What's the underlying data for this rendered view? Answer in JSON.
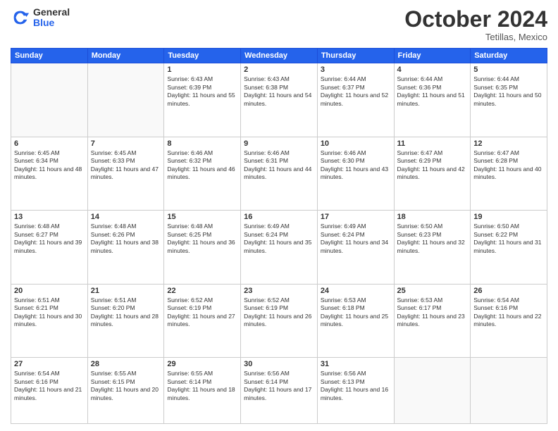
{
  "header": {
    "logo_general": "General",
    "logo_blue": "Blue",
    "month_year": "October 2024",
    "location": "Tetillas, Mexico"
  },
  "days_of_week": [
    "Sunday",
    "Monday",
    "Tuesday",
    "Wednesday",
    "Thursday",
    "Friday",
    "Saturday"
  ],
  "weeks": [
    [
      {
        "day": "",
        "sunrise": "",
        "sunset": "",
        "daylight": ""
      },
      {
        "day": "",
        "sunrise": "",
        "sunset": "",
        "daylight": ""
      },
      {
        "day": "1",
        "sunrise": "Sunrise: 6:43 AM",
        "sunset": "Sunset: 6:39 PM",
        "daylight": "Daylight: 11 hours and 55 minutes."
      },
      {
        "day": "2",
        "sunrise": "Sunrise: 6:43 AM",
        "sunset": "Sunset: 6:38 PM",
        "daylight": "Daylight: 11 hours and 54 minutes."
      },
      {
        "day": "3",
        "sunrise": "Sunrise: 6:44 AM",
        "sunset": "Sunset: 6:37 PM",
        "daylight": "Daylight: 11 hours and 52 minutes."
      },
      {
        "day": "4",
        "sunrise": "Sunrise: 6:44 AM",
        "sunset": "Sunset: 6:36 PM",
        "daylight": "Daylight: 11 hours and 51 minutes."
      },
      {
        "day": "5",
        "sunrise": "Sunrise: 6:44 AM",
        "sunset": "Sunset: 6:35 PM",
        "daylight": "Daylight: 11 hours and 50 minutes."
      }
    ],
    [
      {
        "day": "6",
        "sunrise": "Sunrise: 6:45 AM",
        "sunset": "Sunset: 6:34 PM",
        "daylight": "Daylight: 11 hours and 48 minutes."
      },
      {
        "day": "7",
        "sunrise": "Sunrise: 6:45 AM",
        "sunset": "Sunset: 6:33 PM",
        "daylight": "Daylight: 11 hours and 47 minutes."
      },
      {
        "day": "8",
        "sunrise": "Sunrise: 6:46 AM",
        "sunset": "Sunset: 6:32 PM",
        "daylight": "Daylight: 11 hours and 46 minutes."
      },
      {
        "day": "9",
        "sunrise": "Sunrise: 6:46 AM",
        "sunset": "Sunset: 6:31 PM",
        "daylight": "Daylight: 11 hours and 44 minutes."
      },
      {
        "day": "10",
        "sunrise": "Sunrise: 6:46 AM",
        "sunset": "Sunset: 6:30 PM",
        "daylight": "Daylight: 11 hours and 43 minutes."
      },
      {
        "day": "11",
        "sunrise": "Sunrise: 6:47 AM",
        "sunset": "Sunset: 6:29 PM",
        "daylight": "Daylight: 11 hours and 42 minutes."
      },
      {
        "day": "12",
        "sunrise": "Sunrise: 6:47 AM",
        "sunset": "Sunset: 6:28 PM",
        "daylight": "Daylight: 11 hours and 40 minutes."
      }
    ],
    [
      {
        "day": "13",
        "sunrise": "Sunrise: 6:48 AM",
        "sunset": "Sunset: 6:27 PM",
        "daylight": "Daylight: 11 hours and 39 minutes."
      },
      {
        "day": "14",
        "sunrise": "Sunrise: 6:48 AM",
        "sunset": "Sunset: 6:26 PM",
        "daylight": "Daylight: 11 hours and 38 minutes."
      },
      {
        "day": "15",
        "sunrise": "Sunrise: 6:48 AM",
        "sunset": "Sunset: 6:25 PM",
        "daylight": "Daylight: 11 hours and 36 minutes."
      },
      {
        "day": "16",
        "sunrise": "Sunrise: 6:49 AM",
        "sunset": "Sunset: 6:24 PM",
        "daylight": "Daylight: 11 hours and 35 minutes."
      },
      {
        "day": "17",
        "sunrise": "Sunrise: 6:49 AM",
        "sunset": "Sunset: 6:24 PM",
        "daylight": "Daylight: 11 hours and 34 minutes."
      },
      {
        "day": "18",
        "sunrise": "Sunrise: 6:50 AM",
        "sunset": "Sunset: 6:23 PM",
        "daylight": "Daylight: 11 hours and 32 minutes."
      },
      {
        "day": "19",
        "sunrise": "Sunrise: 6:50 AM",
        "sunset": "Sunset: 6:22 PM",
        "daylight": "Daylight: 11 hours and 31 minutes."
      }
    ],
    [
      {
        "day": "20",
        "sunrise": "Sunrise: 6:51 AM",
        "sunset": "Sunset: 6:21 PM",
        "daylight": "Daylight: 11 hours and 30 minutes."
      },
      {
        "day": "21",
        "sunrise": "Sunrise: 6:51 AM",
        "sunset": "Sunset: 6:20 PM",
        "daylight": "Daylight: 11 hours and 28 minutes."
      },
      {
        "day": "22",
        "sunrise": "Sunrise: 6:52 AM",
        "sunset": "Sunset: 6:19 PM",
        "daylight": "Daylight: 11 hours and 27 minutes."
      },
      {
        "day": "23",
        "sunrise": "Sunrise: 6:52 AM",
        "sunset": "Sunset: 6:19 PM",
        "daylight": "Daylight: 11 hours and 26 minutes."
      },
      {
        "day": "24",
        "sunrise": "Sunrise: 6:53 AM",
        "sunset": "Sunset: 6:18 PM",
        "daylight": "Daylight: 11 hours and 25 minutes."
      },
      {
        "day": "25",
        "sunrise": "Sunrise: 6:53 AM",
        "sunset": "Sunset: 6:17 PM",
        "daylight": "Daylight: 11 hours and 23 minutes."
      },
      {
        "day": "26",
        "sunrise": "Sunrise: 6:54 AM",
        "sunset": "Sunset: 6:16 PM",
        "daylight": "Daylight: 11 hours and 22 minutes."
      }
    ],
    [
      {
        "day": "27",
        "sunrise": "Sunrise: 6:54 AM",
        "sunset": "Sunset: 6:16 PM",
        "daylight": "Daylight: 11 hours and 21 minutes."
      },
      {
        "day": "28",
        "sunrise": "Sunrise: 6:55 AM",
        "sunset": "Sunset: 6:15 PM",
        "daylight": "Daylight: 11 hours and 20 minutes."
      },
      {
        "day": "29",
        "sunrise": "Sunrise: 6:55 AM",
        "sunset": "Sunset: 6:14 PM",
        "daylight": "Daylight: 11 hours and 18 minutes."
      },
      {
        "day": "30",
        "sunrise": "Sunrise: 6:56 AM",
        "sunset": "Sunset: 6:14 PM",
        "daylight": "Daylight: 11 hours and 17 minutes."
      },
      {
        "day": "31",
        "sunrise": "Sunrise: 6:56 AM",
        "sunset": "Sunset: 6:13 PM",
        "daylight": "Daylight: 11 hours and 16 minutes."
      },
      {
        "day": "",
        "sunrise": "",
        "sunset": "",
        "daylight": ""
      },
      {
        "day": "",
        "sunrise": "",
        "sunset": "",
        "daylight": ""
      }
    ]
  ]
}
